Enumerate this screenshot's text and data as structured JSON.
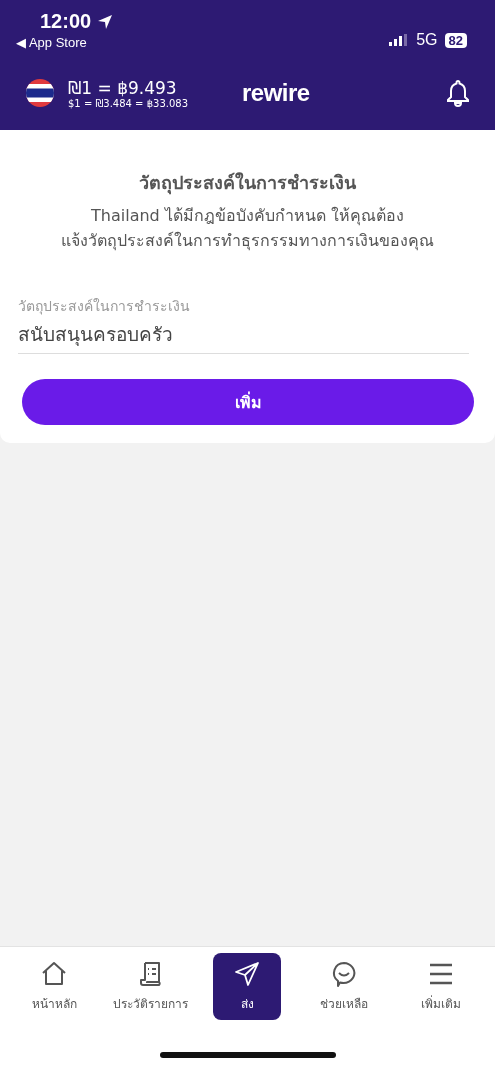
{
  "status_bar": {
    "time": "12:00",
    "back_label": "◀ App Store",
    "network": "5G",
    "battery": "82"
  },
  "header": {
    "rate_main": "₪1 = ฿9.493",
    "rate_sub": "$1 = ₪3.484 = ฿33.083",
    "logo": "rewire"
  },
  "card": {
    "title": "วัตถุประสงค์ในการชำระเงิน",
    "message": "Thailand ได้มีกฎข้อบังคับกำหนด ให้คุณต้อง\nแจ้งวัตถุประสงค์ในการทำธุรกรรมทางการเงินของคุณ",
    "field": {
      "label": "วัตถุประสงค์ในการชำระเงิน",
      "value": "สนับสนุนครอบครัว"
    },
    "button": "เพิ่ม"
  },
  "tab_bar": [
    {
      "kind": "home",
      "label": "หน้าหลัก",
      "selected": false
    },
    {
      "kind": "history",
      "label": "ประวัติรายการ",
      "selected": false
    },
    {
      "kind": "send",
      "label": "ส่ง",
      "selected": true
    },
    {
      "kind": "help",
      "label": "ช่วยเหลือ",
      "selected": false
    },
    {
      "kind": "more",
      "label": "เพิ่มเติม",
      "selected": false
    }
  ]
}
